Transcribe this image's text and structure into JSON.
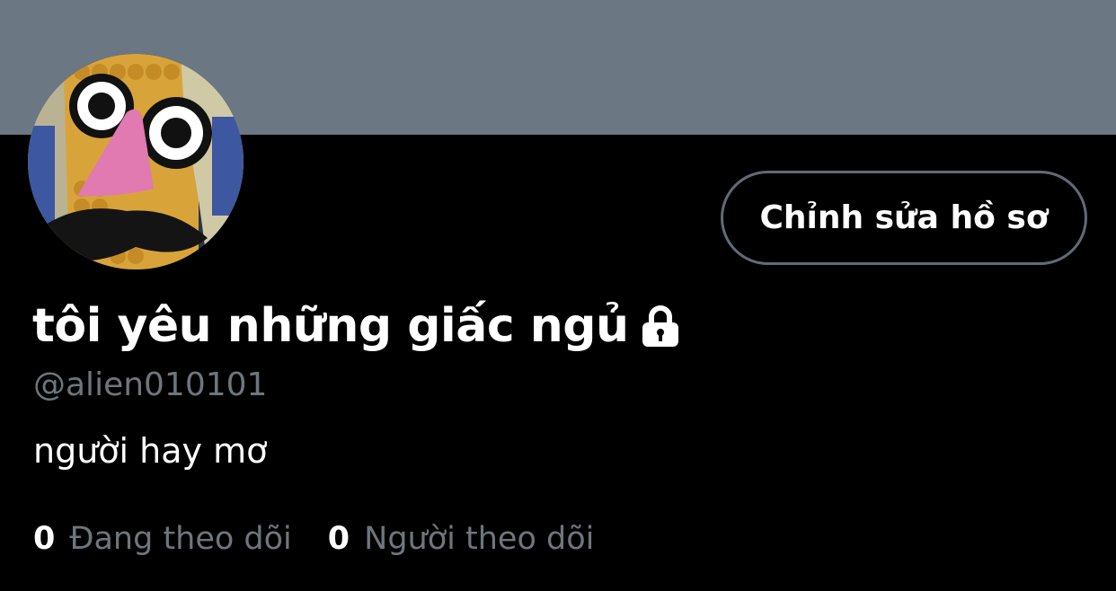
{
  "profile": {
    "display_name": "tôi yêu những giấc ngủ",
    "handle": "@alien010101",
    "bio": "người hay mơ",
    "edit_button_label": "Chỉnh sửa hồ sơ",
    "protected_icon": "lock-icon"
  },
  "stats": {
    "following_count": "0",
    "following_label": "Đang theo dõi",
    "followers_count": "0",
    "followers_label": "Người theo dõi"
  },
  "colors": {
    "banner": "#6b7783",
    "background": "#000000",
    "secondary_text": "#6e767d",
    "button_border": "#5f6b78"
  }
}
